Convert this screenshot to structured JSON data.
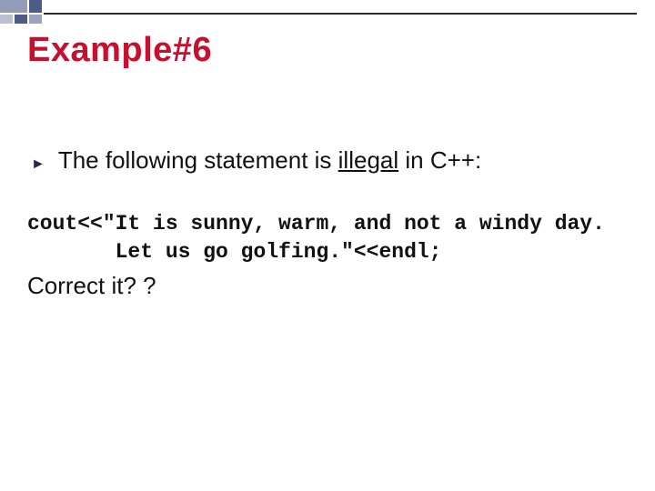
{
  "title": "Example#6",
  "bullet": {
    "prefix": "The following statement is ",
    "illegal": "illegal",
    "suffix": " in C++:"
  },
  "code_line1": "cout<<\"It is sunny, warm, and not a windy day.",
  "code_line2": "       Let us go golfing.\"<<endl;",
  "prompt": "Correct it? ?"
}
